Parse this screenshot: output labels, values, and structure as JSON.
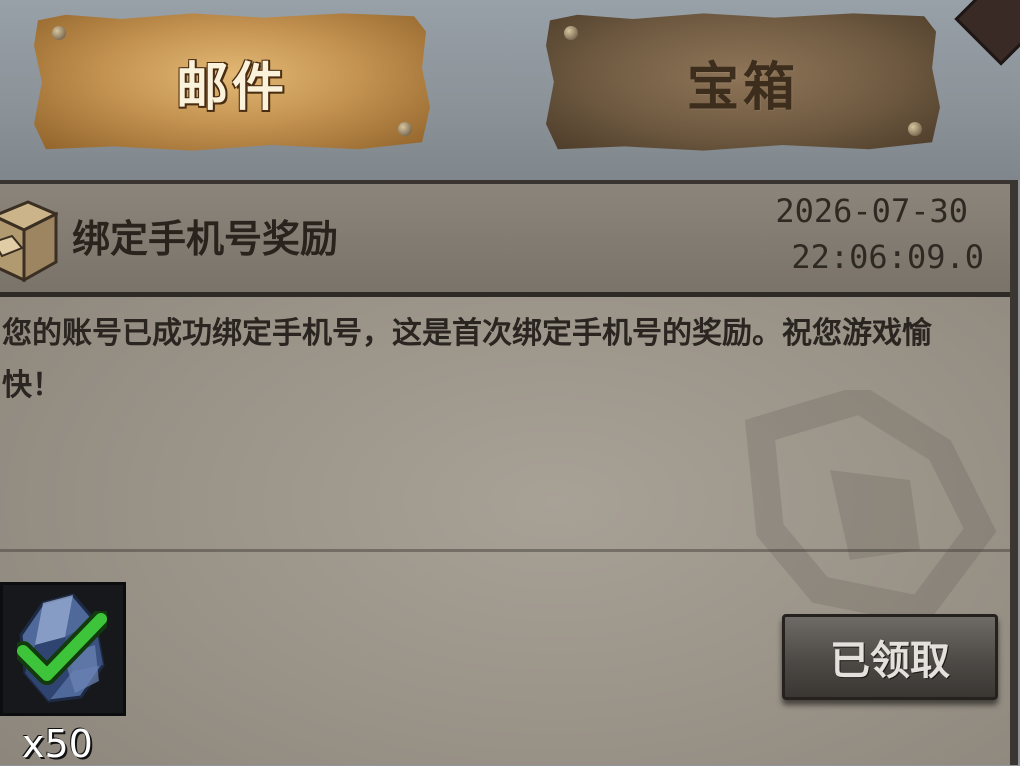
{
  "tabs": {
    "mail_label": "邮件",
    "chest_label": "宝箱"
  },
  "mail": {
    "title": "绑定手机号奖励",
    "date": "2026-07-30",
    "time": "22:06:09.0",
    "body": "您的账号已成功绑定手机号，这是首次绑定手机号的奖励。祝您游戏愉快！"
  },
  "reward": {
    "icon": "crystal-icon",
    "claimed_icon": "checkmark-icon",
    "count": "x50"
  },
  "claim_button": {
    "label": "已领取"
  },
  "colors": {
    "active_tab": "#c49352",
    "inactive_tab": "#6f5a41",
    "panel": "#9a9388",
    "check": "#3ec43a"
  }
}
